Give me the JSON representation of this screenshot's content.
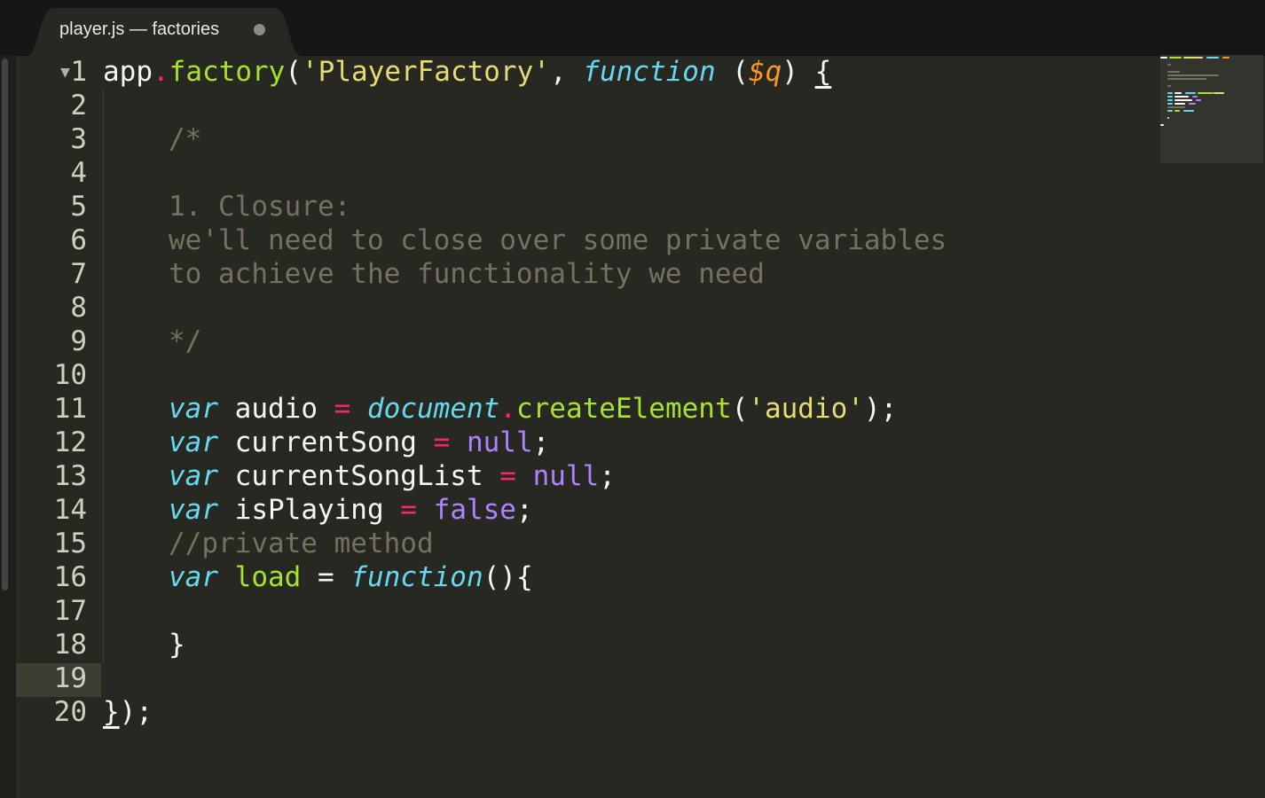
{
  "tab": {
    "title": "player.js — factories",
    "dirty": true
  },
  "gutter": {
    "line_numbers": [
      "1",
      "2",
      "3",
      "4",
      "5",
      "6",
      "7",
      "8",
      "9",
      "10",
      "11",
      "12",
      "13",
      "14",
      "15",
      "16",
      "17",
      "18",
      "19",
      "20"
    ],
    "current_line": "19",
    "fold_marker": "▼"
  },
  "code": {
    "l1": {
      "a": "app",
      "dot": ".",
      "fn": "factory",
      "p1": "(",
      "str": "'PlayerFactory'",
      "comma": ", ",
      "kw": "function",
      "sp": " (",
      "param": "$q",
      "p2": ") ",
      "brace": "{"
    },
    "l3": "/*",
    "l5": "1. Closure:",
    "l6": "we'll need to close over some private variables",
    "l7": "to achieve the functionality we need",
    "l9": "*/",
    "l11": {
      "kw": "var",
      "name": " audio ",
      "op": "=",
      "sp": " ",
      "obj": "document",
      "dot": ".",
      "fn": "createElement",
      "p1": "(",
      "str": "'audio'",
      "end": ");"
    },
    "l12": {
      "kw": "var",
      "name": " currentSong ",
      "op": "=",
      "sp": " ",
      "val": "null",
      "end": ";"
    },
    "l13": {
      "kw": "var",
      "name": " currentSongList ",
      "op": "=",
      "sp": " ",
      "val": "null",
      "end": ";"
    },
    "l14": {
      "kw": "var",
      "name": " isPlaying ",
      "op": "=",
      "sp": " ",
      "val": "false",
      "end": ";"
    },
    "l15": "//private method",
    "l16": {
      "kw": "var",
      "sp": " ",
      "fn": "load",
      "eq": " = ",
      "fkw": "function",
      "end": "(){"
    },
    "l18": "}",
    "l20": {
      "brace": "}",
      "end": ");"
    }
  },
  "colors": {
    "background": "#272822",
    "keyword": "#66d9ef",
    "function": "#a6e22e",
    "string": "#e6db74",
    "operator": "#f92672",
    "constant": "#ae81ff",
    "parameter": "#fd971f",
    "comment": "#75715e"
  }
}
